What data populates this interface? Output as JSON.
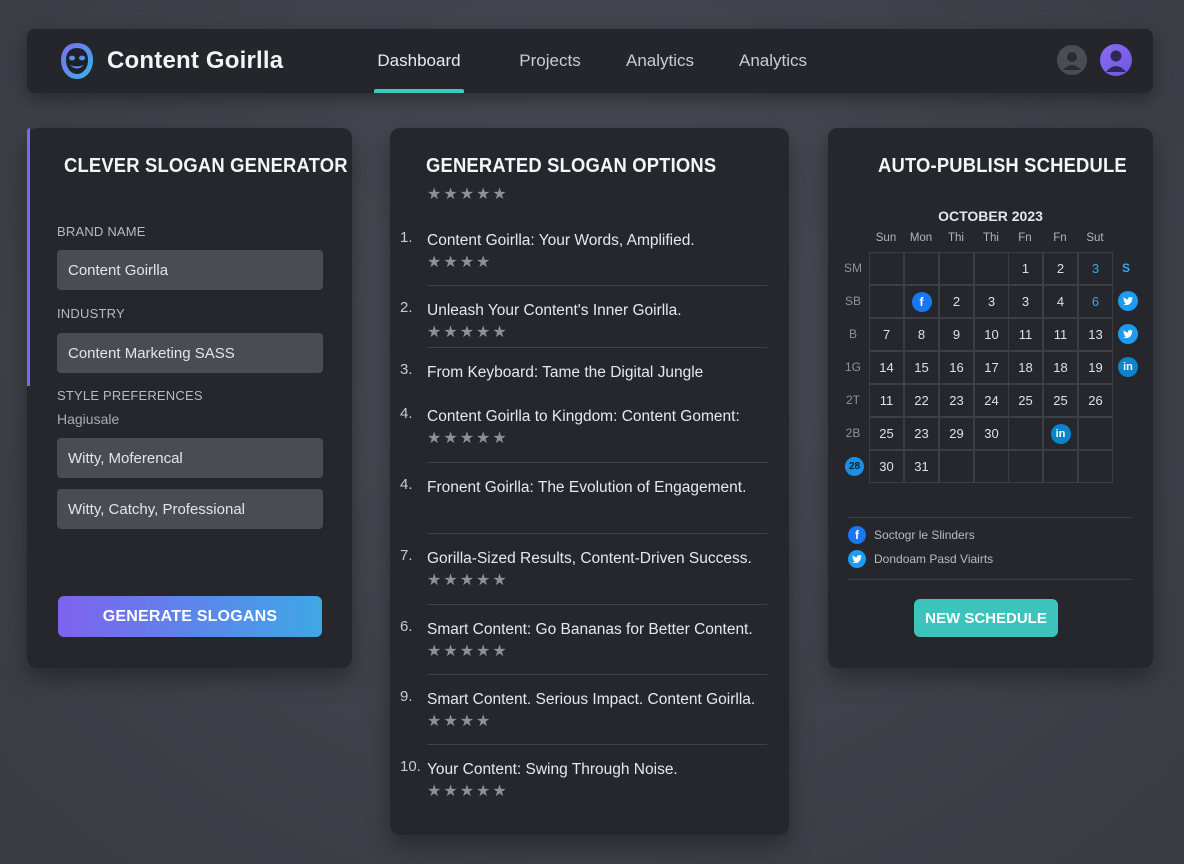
{
  "app": {
    "brand_name": "Content Goirlla"
  },
  "nav": {
    "tabs": [
      {
        "label": "Dashboard",
        "active": true
      },
      {
        "label": "Projects",
        "active": false
      },
      {
        "label": "Analytics",
        "active": false
      },
      {
        "label": "Analytics",
        "active": false
      }
    ]
  },
  "generator": {
    "title": "CLEVER SLOGAN GENERATOR",
    "brand_label": "BRAND NAME",
    "brand_value": "Content Goirlla",
    "industry_label": "INDUSTRY",
    "industry_value": "Content Marketing SASS",
    "style_label": "STYLE PREFERENCES",
    "style_sub": "Hagiusale",
    "style_value_1": "Witty, Moferencal",
    "style_value_2": "Witty, Catchy, Professional",
    "button_label": "GENERATE SLOGANS",
    "button_gradient": [
      "#7f62ee",
      "#3fa7e6"
    ]
  },
  "slogans": {
    "title": "GENERATED SLOGAN OPTIONS",
    "header_rating": 5,
    "items": [
      {
        "num": "1.",
        "text": "Content Goirlla: Your Words, Amplified.",
        "rating": 4
      },
      {
        "num": "2.",
        "text": "Unleash Your Content's Inner Goirlla.",
        "rating": 5
      },
      {
        "num": "3.",
        "text": "From Keyboard: Tame the Digital Jungle",
        "rating": 0
      },
      {
        "num": "4.",
        "text": "Content Goirlla to Kingdom: Content Goment:",
        "rating": 5
      },
      {
        "num": "4.",
        "text": "Fronent Goirlla: The Evolution of Engagement.",
        "rating": 0
      },
      {
        "num": "7.",
        "text": "Gorilla-Sized Results, Content-Driven Success.",
        "rating": 5
      },
      {
        "num": "6.",
        "text": "Smart Content: Go Bananas for Better Content.",
        "rating": 5
      },
      {
        "num": "9.",
        "text": "Smart Content. Serious Impact. Content Goirlla.",
        "rating": 4
      },
      {
        "num": "10.",
        "text": "Your Content: Swing Through Noise.",
        "rating": 5
      }
    ]
  },
  "schedule": {
    "title": "AUTO-PUBLISH SCHEDULE",
    "month": "OCTOBER 2023",
    "weekdays": [
      "Sun",
      "Mon",
      "Thi",
      "Thi",
      "Fn",
      "Fn",
      "Sut"
    ],
    "week_labels": [
      "SM",
      "SB",
      "B",
      "1G",
      "2T",
      "2B",
      "28"
    ],
    "rows": [
      [
        "",
        "",
        "",
        "",
        "1",
        "2",
        "3"
      ],
      [
        "",
        "",
        "2",
        "3",
        "3",
        "4",
        "6"
      ],
      [
        "7",
        "8",
        "9",
        "10",
        "11",
        "11",
        "13"
      ],
      [
        "14",
        "15",
        "16",
        "17",
        "18",
        "18",
        "19"
      ],
      [
        "11",
        "22",
        "23",
        "24",
        "25",
        "25",
        "26"
      ],
      [
        "25",
        "23",
        "29",
        "30",
        "",
        "",
        ""
      ],
      [
        "30",
        "31",
        "",
        "",
        "",
        "",
        ""
      ]
    ],
    "blue_cells": [
      "0-6",
      "1-6"
    ],
    "icon_cells": [
      {
        "cell": "1-1",
        "icon": "facebook"
      },
      {
        "cell": "5-5",
        "icon": "linkedin"
      }
    ],
    "side_icons": [
      {
        "row": 0,
        "icon": "s-text",
        "text": "S"
      },
      {
        "row": 1,
        "icon": "twitter"
      },
      {
        "row": 2,
        "icon": "twitter"
      },
      {
        "row": 3,
        "icon": "linkedin"
      }
    ],
    "legend": [
      {
        "icon": "facebook",
        "label": "Soctogr le Slinders"
      },
      {
        "icon": "twitter",
        "label": "Dondoam Pasd Viairts"
      }
    ],
    "button_label": "NEW SCHEDULE",
    "colors": {
      "facebook": "#1877f2",
      "twitter": "#1d9bf0",
      "linkedin": "#0a85c9",
      "accent": "#3cc3bb"
    }
  }
}
